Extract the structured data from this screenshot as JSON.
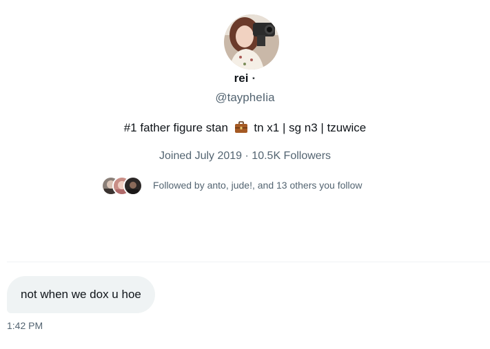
{
  "profile": {
    "display_name": "rei",
    "name_badge": "⋆",
    "handle": "@taypheIia",
    "bio_before": "#1 father figure stan",
    "bio_after": "tn x1 | sg n3 | tzuwice",
    "joined": "Joined July 2019",
    "separator": " · ",
    "followers": "10.5K Followers",
    "followed_by": "Followed by anto, jude!, and 13 others you follow"
  },
  "conversation": {
    "message": "not when we dox u hoe",
    "timestamp": "1:42 PM"
  },
  "colors": {
    "text_primary": "#0f1419",
    "text_secondary": "#536471",
    "bubble_bg": "#eff3f4",
    "divider": "#eff3f4"
  },
  "icons": {
    "briefcase": "briefcase-emoji-icon",
    "star": "sparkle-star-icon"
  }
}
